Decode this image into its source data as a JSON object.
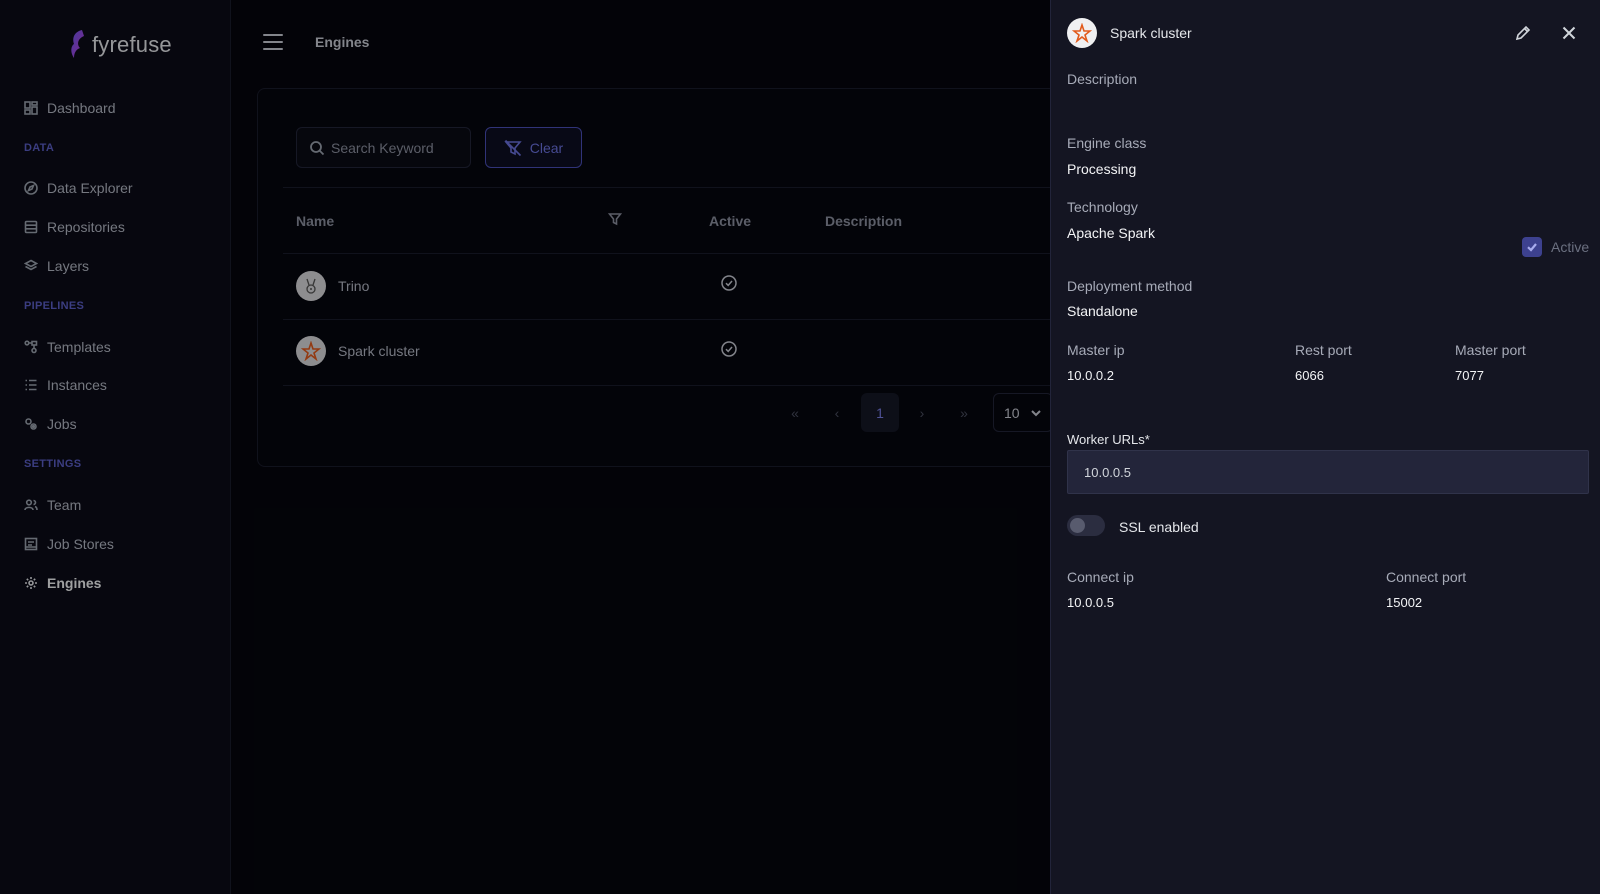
{
  "app": {
    "name": "fyrefuse"
  },
  "sidebar": {
    "dashboard": "Dashboard",
    "sections": {
      "data": "DATA",
      "pipelines": "PIPELINES",
      "settings": "SETTINGS"
    },
    "items": {
      "data_explorer": "Data Explorer",
      "repositories": "Repositories",
      "layers": "Layers",
      "templates": "Templates",
      "instances": "Instances",
      "jobs": "Jobs",
      "team": "Team",
      "job_stores": "Job Stores",
      "engines": "Engines"
    }
  },
  "header": {
    "title": "Engines"
  },
  "toolbar": {
    "search_placeholder": "Search Keyword",
    "clear_label": "Clear"
  },
  "table": {
    "columns": {
      "name": "Name",
      "active": "Active",
      "description": "Description"
    },
    "rows": [
      {
        "name": "Trino",
        "active": true,
        "description": ""
      },
      {
        "name": "Spark cluster",
        "active": true,
        "description": ""
      }
    ]
  },
  "pagination": {
    "current_page": "1",
    "page_size": "10"
  },
  "panel": {
    "title": "Spark cluster",
    "description_label": "Description",
    "engine_class_label": "Engine class",
    "engine_class": "Processing",
    "technology_label": "Technology",
    "technology": "Apache Spark",
    "active_label": "Active",
    "active": true,
    "deployment_label": "Deployment method",
    "deployment": "Standalone",
    "master_ip_label": "Master ip",
    "master_ip": "10.0.0.2",
    "rest_port_label": "Rest port",
    "rest_port": "6066",
    "master_port_label": "Master port",
    "master_port": "7077",
    "worker_urls_label": "Worker URLs*",
    "worker_urls": "10.0.0.5",
    "ssl_label": "SSL enabled",
    "ssl_enabled": false,
    "connect_ip_label": "Connect ip",
    "connect_ip": "10.0.0.5",
    "connect_port_label": "Connect port",
    "connect_port": "15002"
  },
  "colors": {
    "accent": "#5b5fc7",
    "panel_bg": "#141522",
    "page_bg": "#05060d"
  }
}
